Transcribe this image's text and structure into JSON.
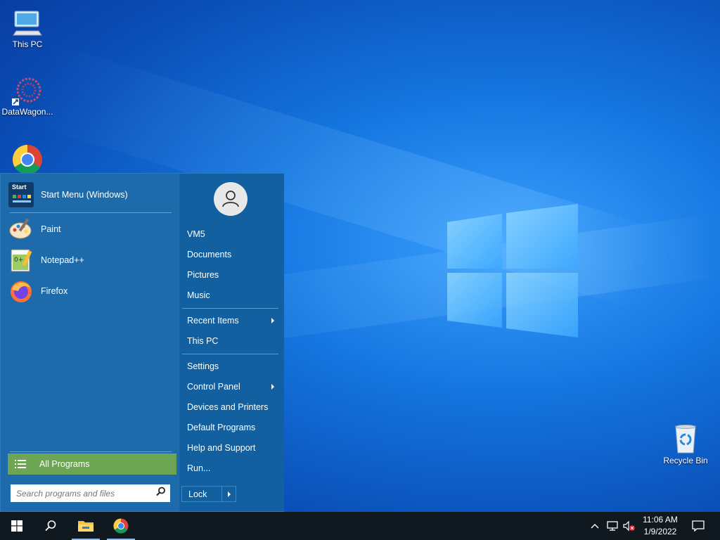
{
  "desktop": {
    "icons": [
      {
        "label": "This PC",
        "icon": "computer-icon"
      },
      {
        "label": "DataWagon...",
        "icon": "datawagon-icon"
      },
      {
        "label": "",
        "icon": "chrome-icon"
      },
      {
        "label": "Recycle Bin",
        "icon": "recycle-bin-icon"
      }
    ]
  },
  "start_menu": {
    "pinned": [
      {
        "label": "Start Menu (Windows)",
        "icon": "start-menu-app-icon"
      },
      {
        "label": "Paint",
        "icon": "paint-icon"
      },
      {
        "label": "Notepad++",
        "icon": "notepadpp-icon"
      },
      {
        "label": "Firefox",
        "icon": "firefox-icon"
      }
    ],
    "start_icon_text": "Start",
    "all_programs": "All Programs",
    "search_placeholder": "Search programs and files",
    "right": {
      "user": "VM5",
      "items": [
        "Documents",
        "Pictures",
        "Music",
        "Recent Items",
        "This PC",
        "Settings",
        "Control Panel",
        "Devices and Printers",
        "Default Programs",
        "Help and Support",
        "Run..."
      ]
    },
    "lock_label": "Lock"
  },
  "taskbar": {
    "time": "11:06 AM",
    "date": "1/9/2022"
  },
  "colors": {
    "all_programs_bg": "#6ea554",
    "menu_bg": "#1565a6",
    "taskbar_bg": "#101820"
  }
}
